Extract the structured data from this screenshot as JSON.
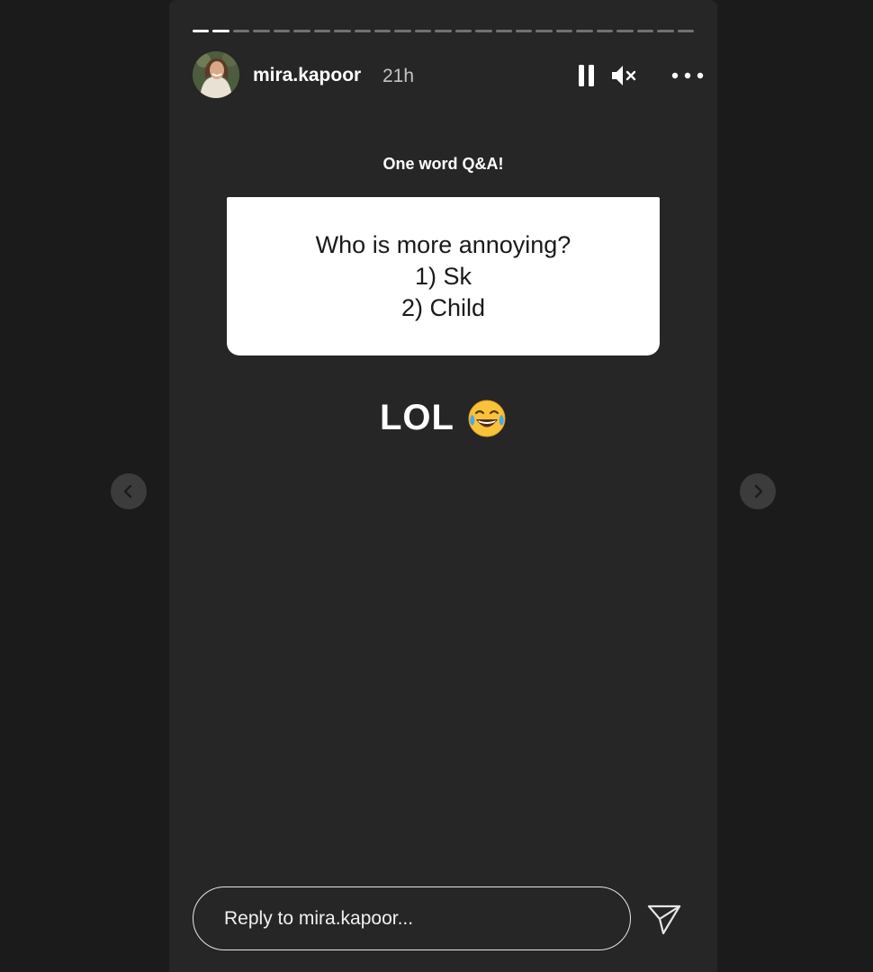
{
  "story": {
    "username": "mira.kapoor",
    "time_ago": "21h",
    "progress_total_segments": 25,
    "progress_completed_segments": 2
  },
  "controls": {
    "pause_icon": "pause-icon",
    "mute_icon": "speaker-muted-icon",
    "more_icon": "more-horizontal-icon"
  },
  "content": {
    "caption": "One word Q&A!",
    "question_lines": [
      "Who is more annoying?",
      "1) Sk",
      "2) Child"
    ],
    "answer_text": "LOL",
    "answer_emoji": "😂"
  },
  "navigation": {
    "prev_icon": "chevron-left-icon",
    "next_icon": "chevron-right-icon"
  },
  "reply": {
    "placeholder": "Reply to mira.kapoor...",
    "send_icon": "send-icon"
  },
  "colors": {
    "page_background": "#1b1b1b",
    "story_background": "#262626",
    "question_box": "#ffffff",
    "text_primary": "#ffffff"
  }
}
